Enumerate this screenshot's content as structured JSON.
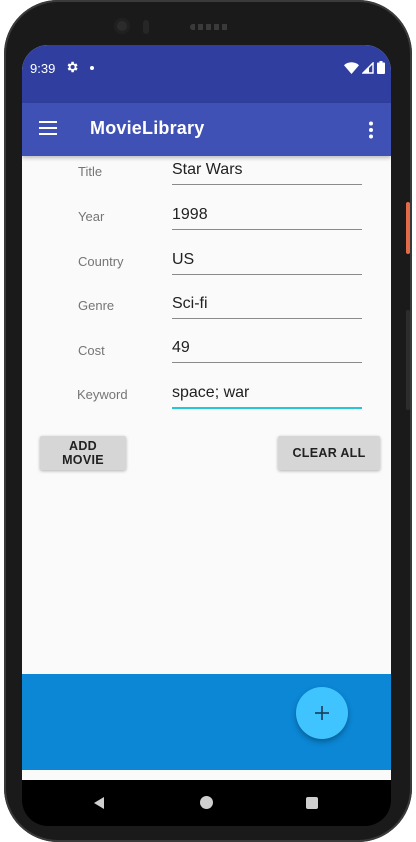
{
  "status_bar": {
    "time": "9:39"
  },
  "app_bar": {
    "title": "MovieLibrary"
  },
  "form": {
    "rows": [
      {
        "label": "Title",
        "value": "Star Wars"
      },
      {
        "label": "Year",
        "value": "1998"
      },
      {
        "label": "Country",
        "value": "US"
      },
      {
        "label": "Genre",
        "value": "Sci-fi"
      },
      {
        "label": "Cost",
        "value": "49"
      },
      {
        "label": "Keyword",
        "value": "space; war"
      }
    ]
  },
  "buttons": {
    "add_movie": "ADD MOVIE",
    "clear_all": "CLEAR ALL"
  },
  "icons": {
    "menu": "menu-icon",
    "overflow": "more-vert-icon",
    "fab": "add-icon",
    "settings": "gear-icon",
    "wifi": "wifi-icon",
    "signal": "signal-icon",
    "battery": "battery-icon"
  },
  "colors": {
    "primary": "#3f51b5",
    "primary_dark": "#303f9f",
    "accent": "#40c4ff",
    "bottom_panel": "#0b87d6",
    "focus_underline": "#26c6da"
  }
}
